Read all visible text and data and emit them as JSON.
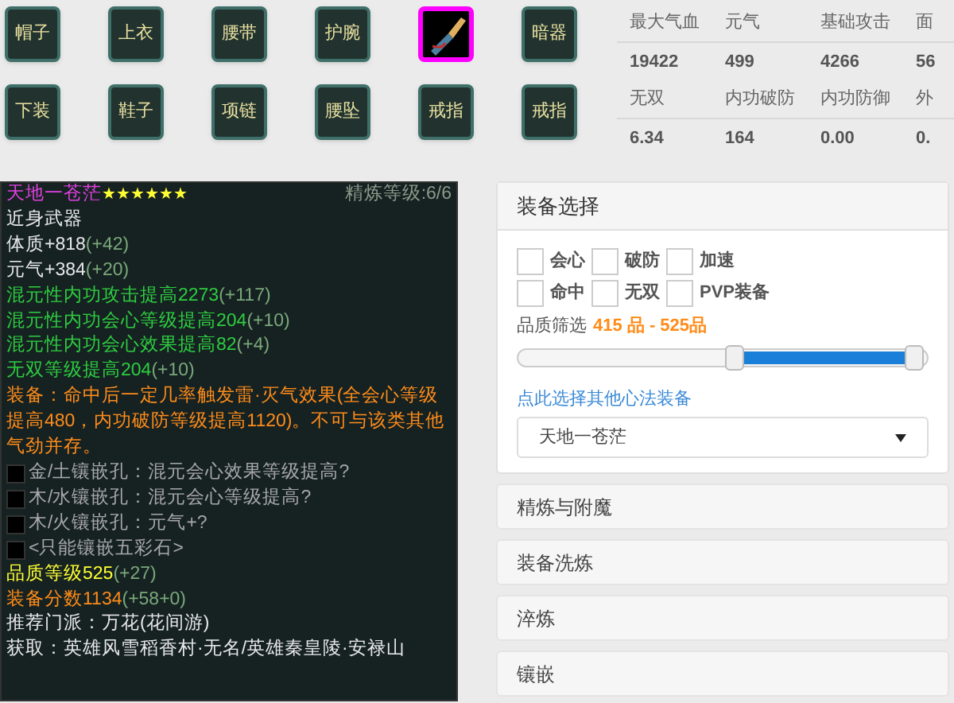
{
  "slots": [
    [
      {
        "label": "帽子",
        "selected": false
      },
      {
        "label": "上衣",
        "selected": false
      },
      {
        "label": "腰带",
        "selected": false
      },
      {
        "label": "护腕",
        "selected": false
      },
      {
        "kind": "item",
        "selected": true
      },
      {
        "label": "暗器",
        "selected": false
      }
    ],
    [
      {
        "label": "下装",
        "selected": false
      },
      {
        "label": "鞋子",
        "selected": false
      },
      {
        "label": "项链",
        "selected": false
      },
      {
        "label": "腰坠",
        "selected": false
      },
      {
        "label": "戒指",
        "selected": false
      },
      {
        "label": "戒指",
        "selected": false
      }
    ]
  ],
  "stats": [
    [
      "最大气血",
      "元气",
      "基础攻击",
      "面"
    ],
    [
      "19422",
      "499",
      "4266",
      "56"
    ],
    [
      "无双",
      "内功破防",
      "内功防御",
      "外"
    ],
    [
      "6.34",
      "164",
      "0.00",
      "0."
    ]
  ],
  "tooltip": {
    "name": "天地一苍茫",
    "star": "★",
    "stars": 6,
    "refine": "精炼等级:6/6",
    "lines": [
      {
        "kind": "plain",
        "text": "近身武器"
      },
      {
        "kind": "attr",
        "text": "体质+818",
        "bonus": "(+42)"
      },
      {
        "kind": "attr",
        "text": "元气+384",
        "bonus": "(+20)"
      },
      {
        "kind": "green",
        "text": "混元性内功攻击提高2273",
        "bonus": "(+117)"
      },
      {
        "kind": "green",
        "text": "混元性内功会心等级提高204",
        "bonus": "(+10)"
      },
      {
        "kind": "green",
        "text": "混元性内功会心效果提高82",
        "bonus": "(+4)"
      },
      {
        "kind": "green",
        "text": "无双等级提高204",
        "bonus": "(+10)"
      },
      {
        "kind": "effect",
        "text": "装备：命中后一定几率触发雷·灭气效果(全会心等级提高480，内功破防等级提高1120)。不可与该类其他气劲并存。"
      },
      {
        "kind": "socket",
        "text": "金/土镶嵌孔：混元会心效果等级提高?"
      },
      {
        "kind": "socket",
        "text": "木/水镶嵌孔：混元会心等级提高?"
      },
      {
        "kind": "socket",
        "text": "木/火镶嵌孔：元气+?"
      },
      {
        "kind": "socket",
        "text": "<只能镶嵌五彩石>"
      },
      {
        "kind": "quality",
        "text": "品质等级525",
        "bonus": "(+27)"
      },
      {
        "kind": "score",
        "text": "装备分数1134",
        "bonus": "(+58+0)"
      },
      {
        "kind": "plain",
        "text": "推荐门派：万花(花间游)"
      },
      {
        "kind": "plain",
        "text": "获取：英雄风雪稻香村·无名/英雄秦皇陵·安禄山"
      }
    ]
  },
  "select_panel": {
    "title": "装备选择",
    "filters": [
      {
        "label": "会心",
        "checked": false
      },
      {
        "label": "破防",
        "checked": false
      },
      {
        "label": "加速",
        "checked": false
      },
      {
        "label": "命中",
        "checked": false
      },
      {
        "label": "无双",
        "checked": false
      },
      {
        "label": "PVP装备",
        "checked": false
      }
    ],
    "quality_label": "品质筛选",
    "quality_range": "415 品 - 525品",
    "slider": [
      {
        "level": 0.53
      },
      {
        "level": 0.97
      }
    ],
    "link": "点此选择其他心法装备",
    "dropdown": "天地一苍茫"
  },
  "sections": [
    {
      "title": "精炼与附魔",
      "expanded": false
    },
    {
      "title": "装备洗炼",
      "expanded": false
    },
    {
      "title": "淬炼",
      "expanded": false
    },
    {
      "title": "镶嵌",
      "expanded": false
    }
  ]
}
